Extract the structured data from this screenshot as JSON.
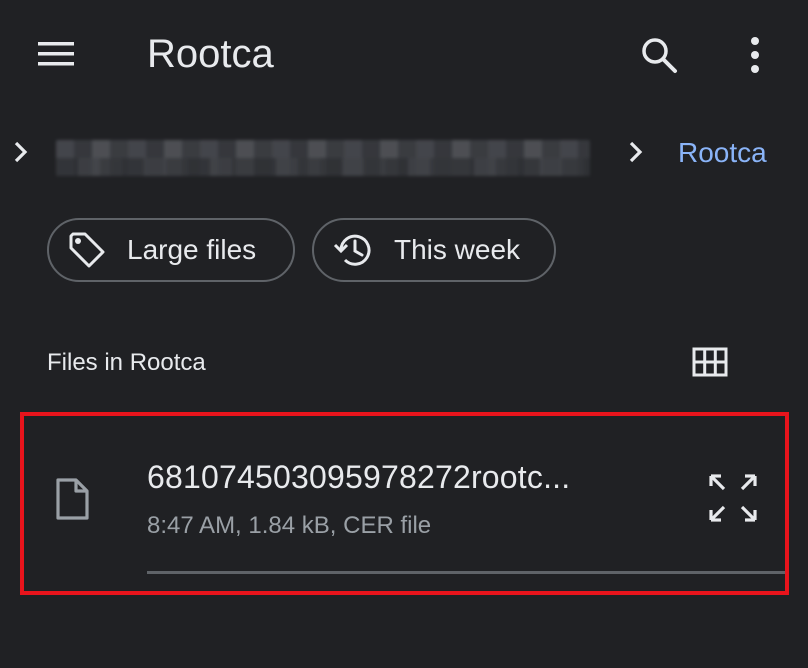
{
  "app_bar": {
    "title": "Rootca",
    "menu_icon": "hamburger-menu-icon",
    "search_icon": "search-icon",
    "more_icon": "more-vert-icon"
  },
  "breadcrumb": {
    "current": "Rootca"
  },
  "filters": {
    "chips": [
      {
        "label": "Large files",
        "icon": "tag-icon"
      },
      {
        "label": "This week",
        "icon": "history-icon"
      }
    ]
  },
  "section": {
    "title": "Files in Rootca",
    "view_toggle_icon": "grid-view-icon"
  },
  "files": [
    {
      "name": "681074503095978272rootc...",
      "meta": "8:47 AM, 1.84 kB, CER file",
      "icon": "file-icon",
      "action_icon": "expand-icon"
    }
  ],
  "colors": {
    "background": "#202124",
    "text_primary": "#e8eaed",
    "text_secondary": "#9aa0a6",
    "accent": "#8ab4f8",
    "outline": "#5f6368",
    "highlight": "#e8141c"
  }
}
